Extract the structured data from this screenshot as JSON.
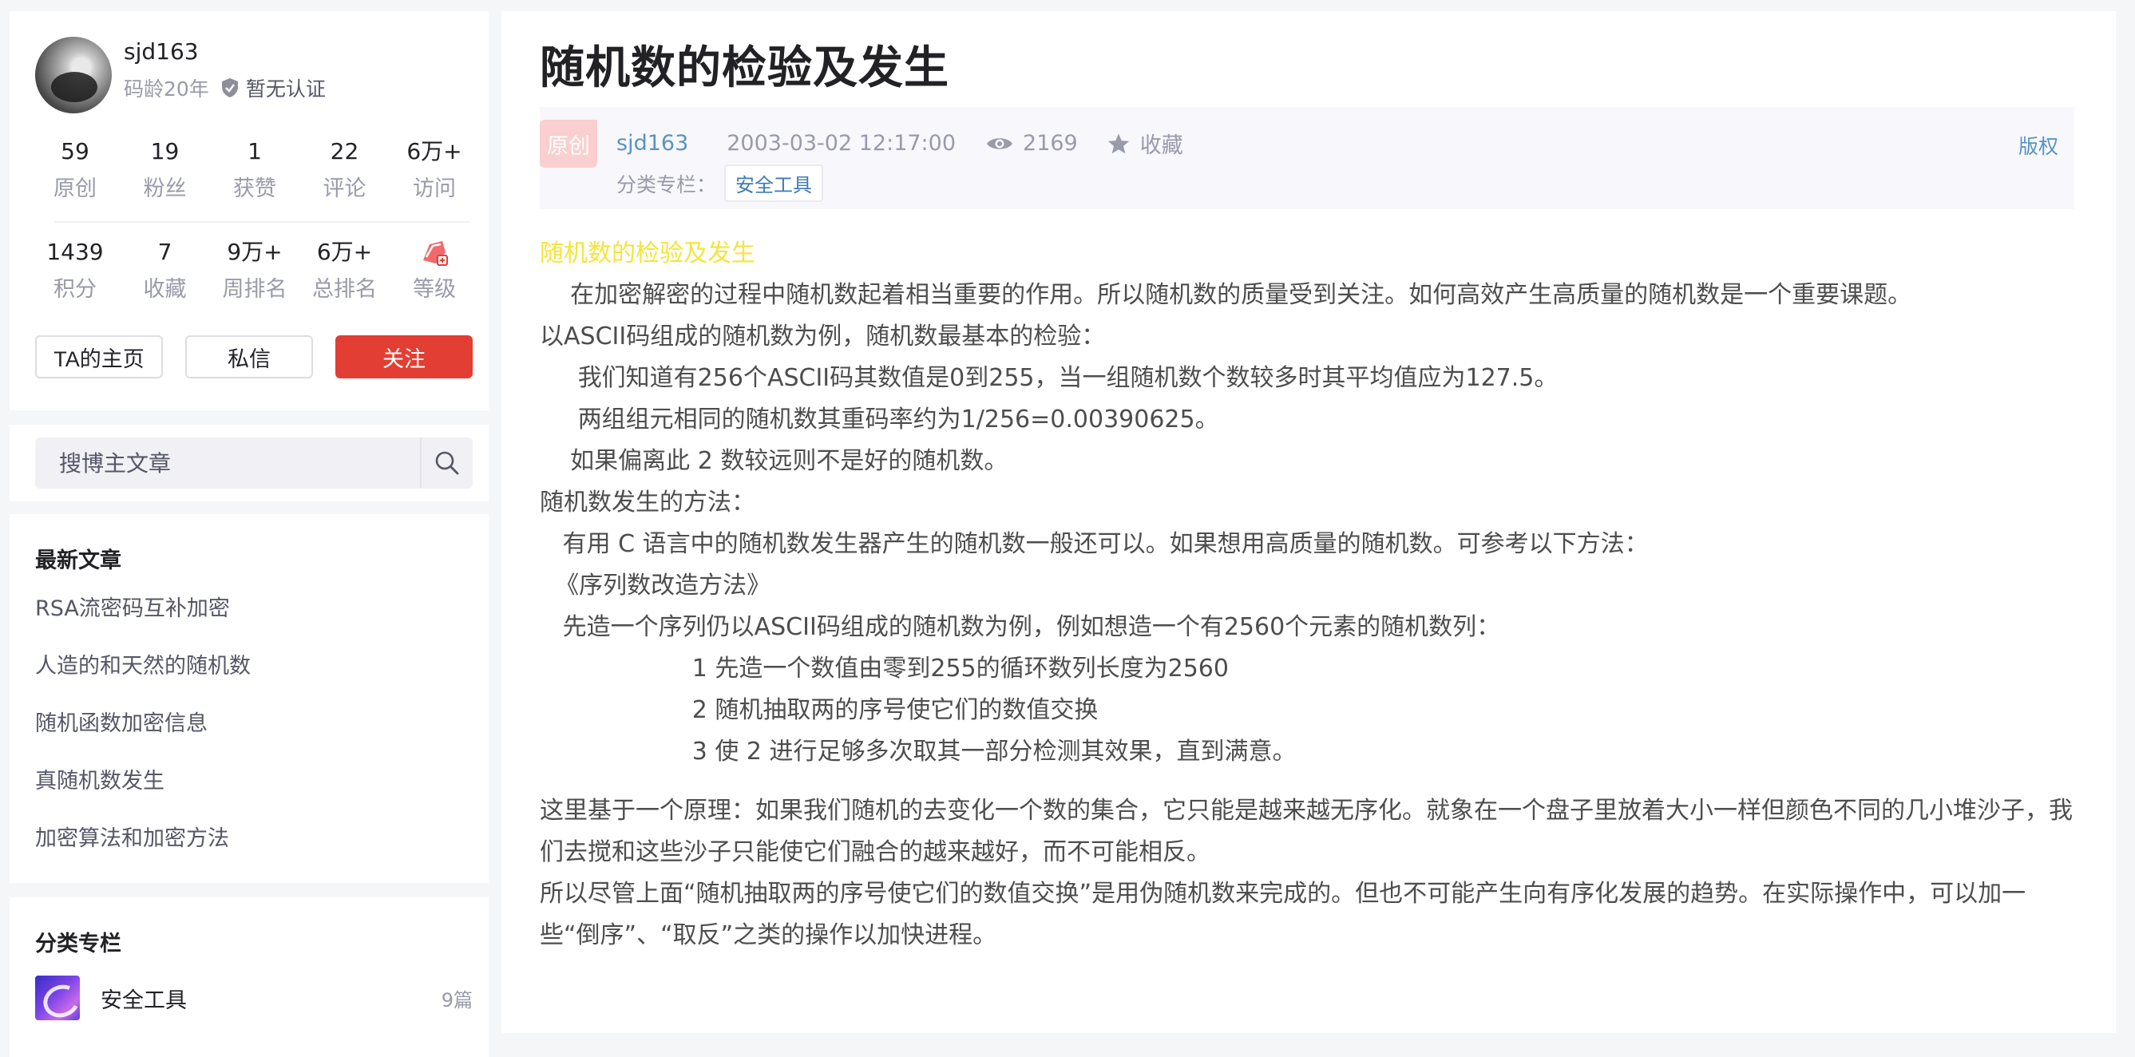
{
  "profile": {
    "username": "sjd163",
    "code_age": "码龄20年",
    "certification": "暂无认证",
    "stats_row1": [
      {
        "num": "59",
        "label": "原创"
      },
      {
        "num": "19",
        "label": "粉丝"
      },
      {
        "num": "1",
        "label": "获赞"
      },
      {
        "num": "22",
        "label": "评论"
      },
      {
        "num": "6万+",
        "label": "访问"
      }
    ],
    "stats_row2": [
      {
        "num": "1439",
        "label": "积分"
      },
      {
        "num": "7",
        "label": "收藏"
      },
      {
        "num": "9万+",
        "label": "周排名"
      },
      {
        "num": "6万+",
        "label": "总排名"
      },
      {
        "num": "",
        "label": "等级"
      }
    ],
    "buttons": {
      "homepage": "TA的主页",
      "message": "私信",
      "follow": "关注"
    }
  },
  "search": {
    "placeholder": "搜博主文章"
  },
  "latest": {
    "title": "最新文章",
    "items": [
      "RSA流密码互补加密",
      "人造的和天然的随机数",
      "随机函数加密信息",
      "真随机数发生",
      "加密算法和加密方法"
    ]
  },
  "category": {
    "title": "分类专栏",
    "name": "安全工具",
    "count": "9篇"
  },
  "article": {
    "title": "随机数的检验及发生",
    "badge": "原创",
    "author": "sjd163",
    "date": "2003-03-02 12:17:00",
    "views": "2169",
    "favorite": "收藏",
    "copyright": "版权",
    "category_label": "分类专栏：",
    "category_tag": "安全工具",
    "heading": "随机数的检验及发生",
    "lines": [
      "    在加密解密的过程中随机数起着相当重要的作用。所以随机数的质量受到关注。如何高效产生高质量的随机数是一个重要课题。",
      "以ASCII码组成的随机数为例，随机数最基本的检验：",
      "     我们知道有256个ASCII码其数值是0到255，当一组随机数个数较多时其平均值应为127.5。",
      "     两组组元相同的随机数其重码率约为1/256=0.00390625。",
      "    如果偏离此 2 数较远则不是好的随机数。",
      "随机数发生的方法：",
      "   有用 C 语言中的随机数发生器产生的随机数一般还可以。如果想用高质量的随机数。可参考以下方法：",
      "  《序列数改造方法》",
      "   先造一个序列仍以ASCII码组成的随机数为例，例如想造一个有2560个元素的随机数列：",
      "                    1 先造一个数值由零到255的循环数列长度为2560",
      "                    2 随机抽取两的序号使它们的数值交换",
      "                    3 使 2 进行足够多次取其一部分检测其效果，直到满意。"
    ],
    "para1": "这里基于一个原理：如果我们随机的去变化一个数的集合，它只能是越来越无序化。就象在一个盘子里放着大小一样但颜色不同的几小堆沙子，我们去搅和这些沙子只能使它们融合的越来越好，而不可能相反。",
    "para2": "所以尽管上面“随机抽取两的序号使它们的数值交换”是用伪随机数来完成的。但也不可能产生向有序化发展的趋势。在实际操作中，可以加一些“倒序”、“取反”之类的操作以加快进程。"
  }
}
